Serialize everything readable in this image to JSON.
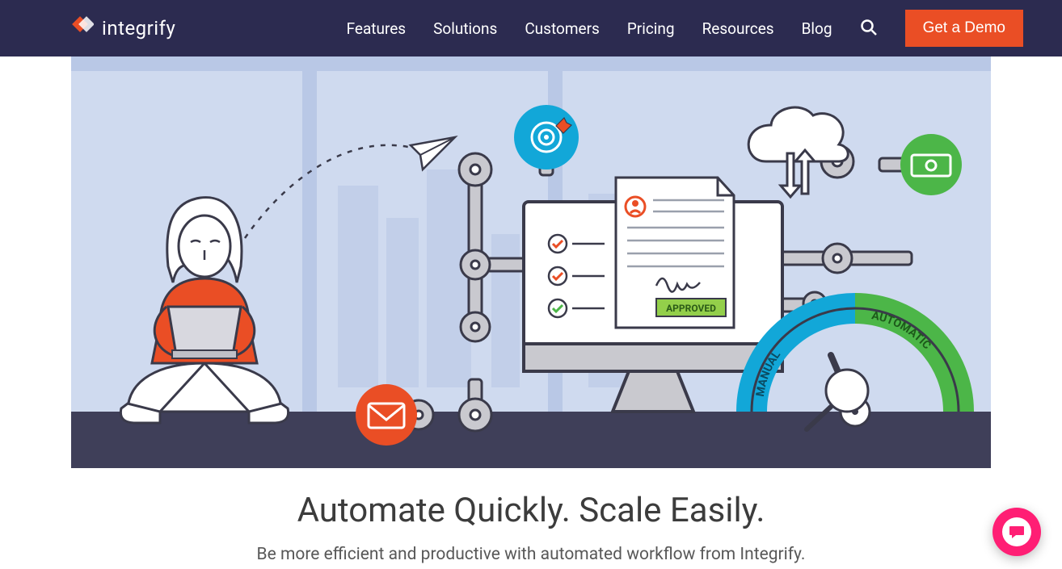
{
  "brand": {
    "name": "integrify"
  },
  "nav": {
    "items": [
      {
        "label": "Features"
      },
      {
        "label": "Solutions"
      },
      {
        "label": "Customers"
      },
      {
        "label": "Pricing"
      },
      {
        "label": "Resources"
      },
      {
        "label": "Blog"
      }
    ],
    "cta_label": "Get a Demo"
  },
  "hero": {
    "headline": "Automate Quickly. Scale Easily.",
    "subhead": "Be more efficient and productive with automated workflow from Integrify.",
    "gauge": {
      "left_label": "MANUAL",
      "right_label": "AUTOMATIC"
    },
    "stamp_label": "APPROVED"
  }
}
